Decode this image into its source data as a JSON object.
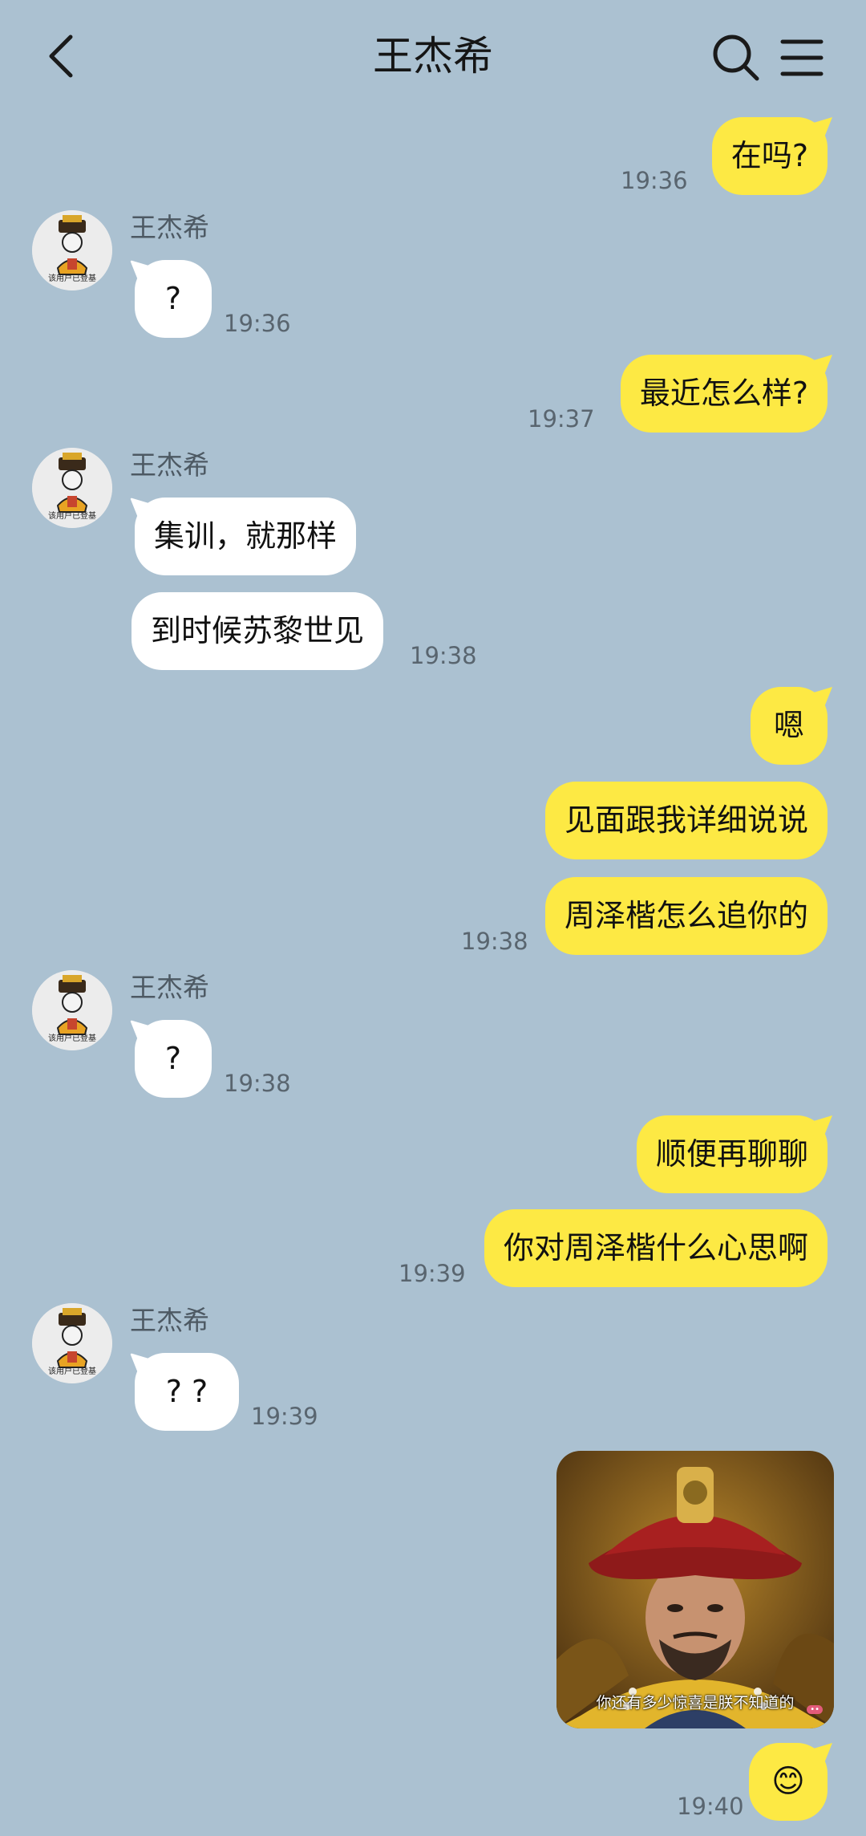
{
  "header": {
    "title": "王杰希",
    "back_icon": "chevron-left-icon",
    "search_icon": "search-icon",
    "menu_icon": "menu-icon"
  },
  "contact": {
    "name": "王杰希",
    "avatar_text": "该用户已登基"
  },
  "messages": [
    {
      "side": "out",
      "text": "在吗?",
      "time": "19:36"
    },
    {
      "side": "in",
      "text": "?",
      "time": "19:36"
    },
    {
      "side": "out",
      "text": "最近怎么样?",
      "time": "19:37"
    },
    {
      "side": "in",
      "text": "集训，就那样",
      "time": ""
    },
    {
      "side": "in",
      "text": "到时候苏黎世见",
      "time": "19:38"
    },
    {
      "side": "out",
      "text": "嗯",
      "time": ""
    },
    {
      "side": "out",
      "text": "见面跟我详细说说",
      "time": ""
    },
    {
      "side": "out",
      "text": "周泽楷怎么追你的",
      "time": "19:38"
    },
    {
      "side": "in",
      "text": "?",
      "time": "19:38"
    },
    {
      "side": "out",
      "text": "顺便再聊聊",
      "time": ""
    },
    {
      "side": "out",
      "text": "你对周泽楷什么心思啊",
      "time": "19:39"
    },
    {
      "side": "in",
      "text": "? ?",
      "time": "19:39"
    },
    {
      "side": "out",
      "type": "image",
      "caption": "你还有多少惊喜是朕不知道的",
      "time": ""
    },
    {
      "side": "out",
      "type": "emoji",
      "text": "😊",
      "emoji_icon": "smiling-face-icon",
      "time": "19:40"
    }
  ],
  "colors": {
    "background": "#abc1d1",
    "incoming_bubble": "#ffffff",
    "outgoing_bubble": "#fde944"
  }
}
